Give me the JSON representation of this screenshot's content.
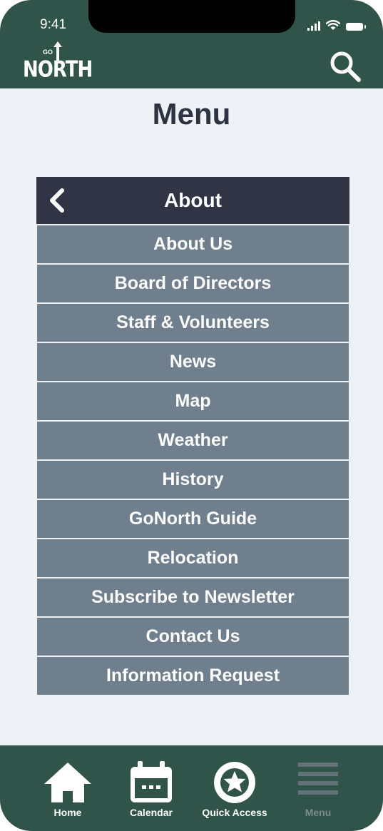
{
  "status_bar": {
    "time": "9:41"
  },
  "app_bar": {
    "logo_text": "NORTH",
    "logo_small_text": "GO",
    "search_icon": "search-icon"
  },
  "page": {
    "title": "Menu"
  },
  "menu": {
    "section_title": "About",
    "back_icon": "chevron-left-icon",
    "items": [
      {
        "label": "About Us"
      },
      {
        "label": "Board of Directors"
      },
      {
        "label": "Staff & Volunteers"
      },
      {
        "label": "News"
      },
      {
        "label": "Map"
      },
      {
        "label": "Weather"
      },
      {
        "label": "History"
      },
      {
        "label": "GoNorth Guide"
      },
      {
        "label": "Relocation"
      },
      {
        "label": "Subscribe to Newsletter"
      },
      {
        "label": "Contact Us"
      },
      {
        "label": "Information Request"
      }
    ]
  },
  "bottom_nav": {
    "items": [
      {
        "label": "Home",
        "icon": "home-icon",
        "active": true
      },
      {
        "label": "Calendar",
        "icon": "calendar-icon",
        "active": true
      },
      {
        "label": "Quick Access",
        "icon": "star-circle-icon",
        "active": true
      },
      {
        "label": "Menu",
        "icon": "hamburger-menu-icon",
        "active": false
      }
    ]
  },
  "colors": {
    "header_green": "#30534a",
    "page_bg": "#eef2f6",
    "menu_header": "#303444",
    "menu_item": "#6f7f8d",
    "title_text": "#2e3342",
    "inactive_nav": "#7b8a8e"
  }
}
